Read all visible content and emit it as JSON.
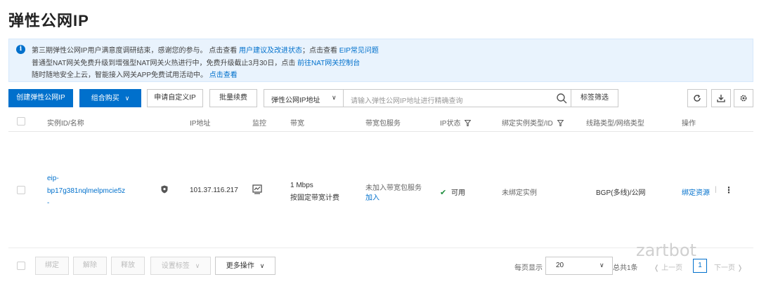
{
  "page": {
    "title": "弹性公网IP"
  },
  "notice": {
    "line1_text": "第三期弹性公网IP用户满意度调研结束，感谢您的参与。 点击查看",
    "line1_link1": "用户建议及改进状态",
    "line1_mid": "；点击查看",
    "line1_link2": "EIP常见问题",
    "line2_text": "普通型NAT网关免费升级到增强型NAT网关火热进行中，免费升级截止3月30日，点击",
    "line2_link": "前往NAT网关控制台",
    "line3_text": "随时随地安全上云，智能接入网关APP免费试用活动中。",
    "line3_link": "点击查看"
  },
  "toolbar": {
    "create_label": "创建弹性公网IP",
    "combo_label": "组合购买",
    "custom_ip_label": "申请自定义IP",
    "batch_renew_label": "批量续费",
    "search_field": "弹性公网IP地址",
    "search_placeholder": "请输入弹性公网IP地址进行精确查询",
    "tag_filter_label": "标签筛选"
  },
  "table": {
    "headers": {
      "id": "实例ID/名称",
      "ip": "IP地址",
      "monitor": "监控",
      "bandwidth": "带宽",
      "bw_package": "带宽包服务",
      "ip_status": "IP状态",
      "bound_type": "绑定实例类型/ID",
      "line_type": "线路类型/网络类型",
      "actions": "操作"
    },
    "rows": [
      {
        "id_line1": "eip-",
        "id_line2": "bp17g381nqlmelpmcie5z",
        "name": "-",
        "ip": "101.37.116.217",
        "bandwidth": "1 Mbps",
        "billing": "按固定带宽计费",
        "package_status": "未加入带宽包服务",
        "package_action": "加入",
        "status": "可用",
        "bound": "未绑定实例",
        "line": "BGP(多线)/公网",
        "action": "绑定资源",
        "more": "⋮"
      }
    ]
  },
  "footer": {
    "bind": "绑定",
    "delete": "解除",
    "release": "释放",
    "set_tags": "设置标签",
    "more_ops": "更多操作",
    "page_size_label": "每页显示",
    "page_size": "20",
    "total": "总共1条",
    "prev": "上一页",
    "page": "1",
    "next": "下一页"
  },
  "watermark": "zartbot",
  "colors": {
    "primary": "#0070cc",
    "success": "#1e8e3e",
    "notice_bg": "#e9f3fd"
  },
  "icons": [
    "info-icon",
    "chevron-down-icon",
    "search-icon",
    "refresh-icon",
    "download-icon",
    "settings-icon",
    "filter-icon",
    "shield-icon",
    "monitor-icon",
    "check-icon",
    "more-icon"
  ]
}
